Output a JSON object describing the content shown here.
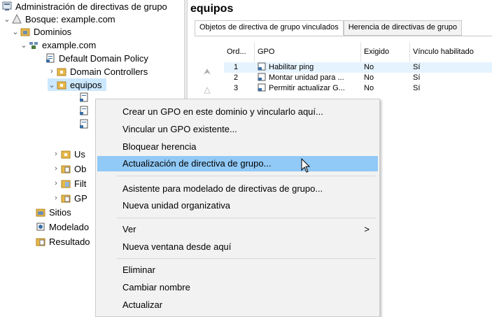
{
  "tree": {
    "root": "Administración de directivas de grupo",
    "forest": "Bosque: example.com",
    "domains": "Dominios",
    "domain": "example.com",
    "default_policy": "Default Domain Policy",
    "domain_controllers": "Domain Controllers",
    "ou_equipos": "equipos",
    "child_users_partial": "Us",
    "child_objects_partial": "Ob",
    "child_filters_partial": "Filt",
    "child_gpo_partial": "GP",
    "sites": "Sitios",
    "modeling_partial": "Modelado",
    "results_partial": "Resultado"
  },
  "panel": {
    "title": "equipos",
    "tabs": [
      "Objetos de directiva de grupo vinculados",
      "Herencia de directivas de grupo"
    ],
    "columns": [
      "Ord...",
      "GPO",
      "Exigido",
      "Vínculo habilitado"
    ],
    "rows": [
      {
        "order": "1",
        "gpo": "Habilitar ping",
        "enforced": "No",
        "enabled": "Sí"
      },
      {
        "order": "2",
        "gpo": "Montar unidad para ...",
        "enforced": "No",
        "enabled": "Sí"
      },
      {
        "order": "3",
        "gpo": "Permitir actualizar G...",
        "enforced": "No",
        "enabled": "Sí"
      }
    ]
  },
  "context_menu": {
    "items": [
      "Crear un GPO en este dominio y vincularlo aquí...",
      "Vincular un GPO existente...",
      "Bloquear herencia",
      "Actualización de directiva de grupo...",
      "Asistente para modelado de directivas de grupo...",
      "Nueva unidad organizativa",
      "Ver",
      "Nueva ventana desde aquí",
      "Eliminar",
      "Cambiar nombre",
      "Actualizar"
    ],
    "submenu_arrow": ">"
  },
  "colors": {
    "selection": "#cce8ff",
    "menu_highlight": "#91c9f7",
    "menu_bg": "#f2f2f2",
    "folder": "#e8b84a"
  }
}
